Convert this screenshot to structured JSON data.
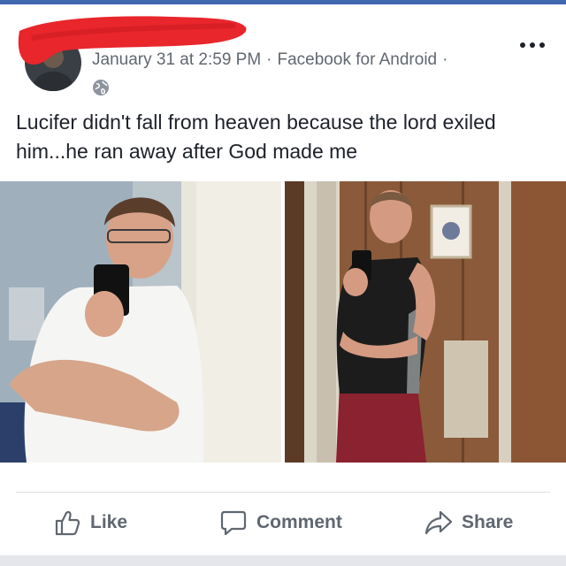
{
  "post": {
    "timestamp": "January 31 at 2:59 PM",
    "source": "Facebook for Android",
    "text": "Lucifer didn't fall from heaven because the lord exiled him...he ran away after God made me",
    "privacy_icon": "globe-icon",
    "options_icon": "more-options-icon"
  },
  "actions": {
    "like_label": "Like",
    "comment_label": "Comment",
    "share_label": "Share"
  },
  "colors": {
    "brand": "#4267b2",
    "redaction": "#e8262c",
    "meta_text": "#616770",
    "action_text": "#606770"
  }
}
